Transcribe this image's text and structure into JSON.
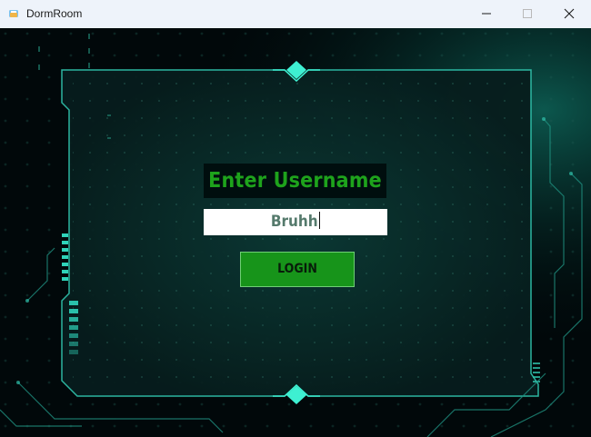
{
  "window": {
    "title": "DormRoom",
    "controls": {
      "minimize": "minimize",
      "maximize": "maximize",
      "close": "close"
    }
  },
  "login": {
    "label": "Enter Username :",
    "username_value": "Bruhh",
    "button_label": "LOGIN"
  },
  "colors": {
    "accent_green": "#1ea31c",
    "button_green": "#17941a",
    "frame_cyan": "#2fd3b9",
    "background": "#01080a"
  },
  "icons": [
    "app-icon",
    "minimize-icon",
    "maximize-icon",
    "close-icon",
    "diamond-icon"
  ]
}
